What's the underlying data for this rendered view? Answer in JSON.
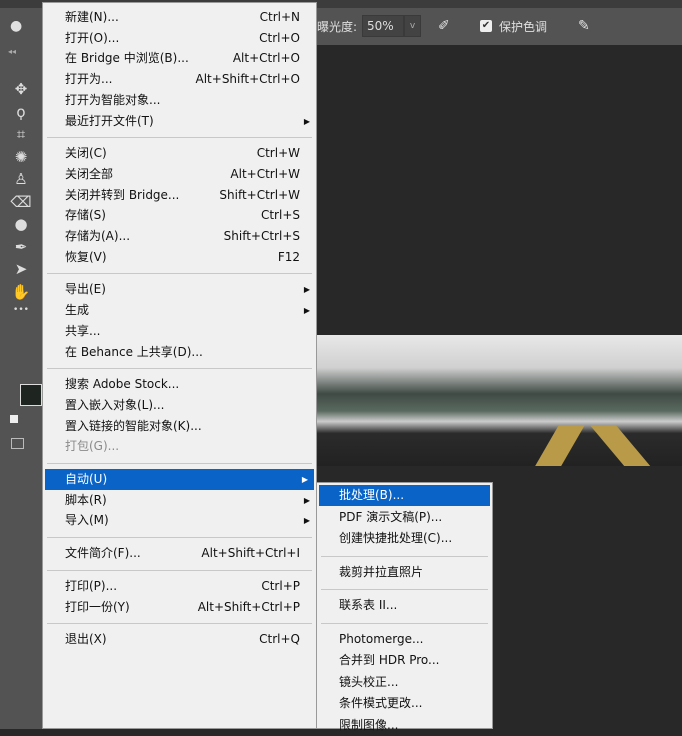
{
  "options_bar": {
    "exposure_label": "曝光度:",
    "exposure_value": "50%",
    "protect_tones_label": "保护色调",
    "protect_tones_checked": true
  },
  "file_menu": [
    {
      "label": "新建(N)...",
      "shortcut": "Ctrl+N"
    },
    {
      "label": "打开(O)...",
      "shortcut": "Ctrl+O"
    },
    {
      "label": "在 Bridge 中浏览(B)...",
      "shortcut": "Alt+Ctrl+O"
    },
    {
      "label": "打开为...",
      "shortcut": "Alt+Shift+Ctrl+O"
    },
    {
      "label": "打开为智能对象..."
    },
    {
      "label": "最近打开文件(T)",
      "submenu": true
    },
    {
      "sep": true
    },
    {
      "label": "关闭(C)",
      "shortcut": "Ctrl+W"
    },
    {
      "label": "关闭全部",
      "shortcut": "Alt+Ctrl+W"
    },
    {
      "label": "关闭并转到 Bridge...",
      "shortcut": "Shift+Ctrl+W"
    },
    {
      "label": "存储(S)",
      "shortcut": "Ctrl+S"
    },
    {
      "label": "存储为(A)...",
      "shortcut": "Shift+Ctrl+S"
    },
    {
      "label": "恢复(V)",
      "shortcut": "F12"
    },
    {
      "sep": true
    },
    {
      "label": "导出(E)",
      "submenu": true
    },
    {
      "label": "生成",
      "submenu": true
    },
    {
      "label": "共享..."
    },
    {
      "label": "在 Behance 上共享(D)..."
    },
    {
      "sep": true
    },
    {
      "label": "搜索 Adobe Stock..."
    },
    {
      "label": "置入嵌入对象(L)..."
    },
    {
      "label": "置入链接的智能对象(K)..."
    },
    {
      "label": "打包(G)...",
      "disabled": true
    },
    {
      "sep": true
    },
    {
      "label": "自动(U)",
      "submenu": true,
      "highlighted": true
    },
    {
      "label": "脚本(R)",
      "submenu": true
    },
    {
      "label": "导入(M)",
      "submenu": true
    },
    {
      "sep": true
    },
    {
      "label": "文件简介(F)...",
      "shortcut": "Alt+Shift+Ctrl+I"
    },
    {
      "sep": true
    },
    {
      "label": "打印(P)...",
      "shortcut": "Ctrl+P"
    },
    {
      "label": "打印一份(Y)",
      "shortcut": "Alt+Shift+Ctrl+P"
    },
    {
      "sep": true
    },
    {
      "label": "退出(X)",
      "shortcut": "Ctrl+Q"
    }
  ],
  "automate_submenu": [
    {
      "label": "批处理(B)...",
      "highlighted": true
    },
    {
      "label": "PDF 演示文稿(P)..."
    },
    {
      "label": "创建快捷批处理(C)..."
    },
    {
      "sep": true
    },
    {
      "label": "裁剪并拉直照片"
    },
    {
      "sep": true
    },
    {
      "label": "联系表 II..."
    },
    {
      "sep": true
    },
    {
      "label": "Photomerge..."
    },
    {
      "label": "合并到 HDR Pro..."
    },
    {
      "label": "镜头校正..."
    },
    {
      "label": "条件模式更改..."
    },
    {
      "label": "限制图像..."
    }
  ],
  "tools": [
    {
      "icon": "move-icon",
      "glyph": "✥"
    },
    {
      "icon": "lasso-icon",
      "glyph": "ϙ"
    },
    {
      "icon": "crop-icon",
      "glyph": "⌗"
    },
    {
      "icon": "patch-icon",
      "glyph": "✺"
    },
    {
      "icon": "stamp-icon",
      "glyph": "♙"
    },
    {
      "icon": "eraser-icon",
      "glyph": "⌫"
    },
    {
      "icon": "blur-drop-icon",
      "glyph": "●"
    },
    {
      "icon": "pen-icon",
      "glyph": "✒"
    },
    {
      "icon": "select-arrow-icon",
      "glyph": "➤"
    },
    {
      "icon": "hand-icon",
      "glyph": "✋"
    },
    {
      "icon": "more-icon",
      "glyph": "•••"
    }
  ],
  "colors": {
    "highlight": "#0a64c8",
    "menu_bg": "#f0f0f0",
    "panel": "#535353",
    "canvas": "#282828"
  }
}
